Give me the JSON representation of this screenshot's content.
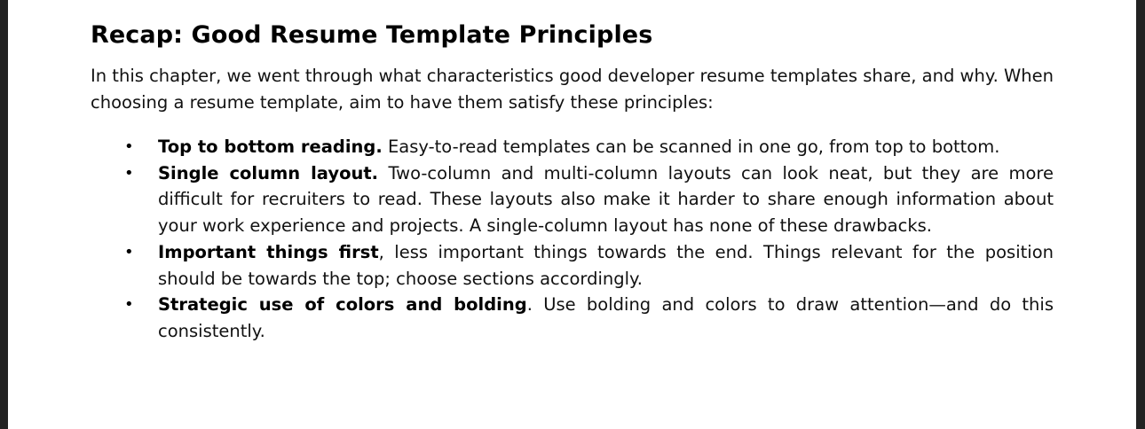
{
  "document": {
    "title": "Recap: Good Resume Template Principles",
    "intro": "In this chapter, we went through what characteristics good developer resume templates share, and why. When choosing a resume template, aim to have them satisfy these principles:",
    "bullet_glyph": "•",
    "principles": [
      {
        "bold": "Top to bottom reading.",
        "text": " Easy-to-read templates can be scanned in one go, from top to bottom."
      },
      {
        "bold": "Single column layout.",
        "text": " Two-column and multi-column layouts can look neat, but they are more difficult for recruiters to read. These layouts also make it harder to share enough information about your work experience and projects. A single-column layout has none of these drawbacks."
      },
      {
        "bold": "Important things first",
        "text": ", less important things towards the end. Things relevant for the position should be towards the top; choose sections accordingly."
      },
      {
        "bold": "Strategic use of colors and bolding",
        "text": ". Use bolding and colors to draw attention—and do this consistently."
      }
    ]
  }
}
